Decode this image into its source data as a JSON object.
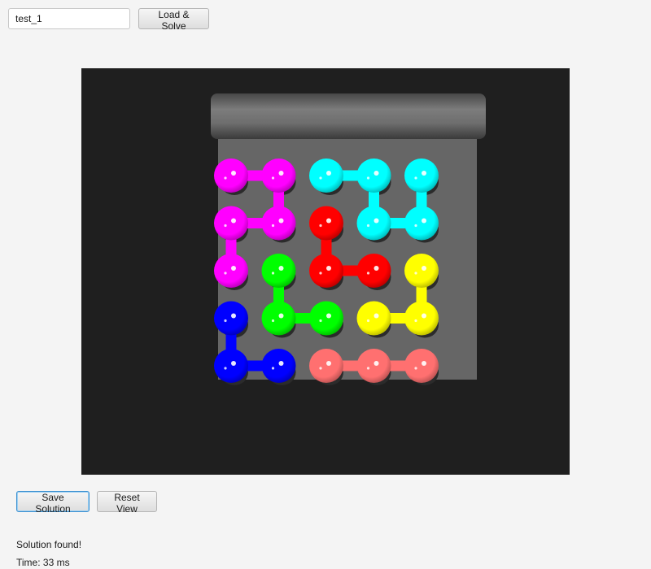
{
  "toolbar": {
    "file_input_value": "test_1",
    "load_button_label": "Load & Solve"
  },
  "puzzle": {
    "grid_rows": 5,
    "grid_cols": 5,
    "paths": [
      {
        "color": "#ff00ff",
        "cells": [
          [
            2,
            0
          ],
          [
            1,
            0
          ],
          [
            1,
            1
          ],
          [
            0,
            1
          ],
          [
            0,
            0
          ]
        ]
      },
      {
        "color": "#00ffff",
        "cells": [
          [
            0,
            2
          ],
          [
            0,
            3
          ],
          [
            1,
            3
          ],
          [
            1,
            4
          ],
          [
            0,
            4
          ]
        ]
      },
      {
        "color": "#ff0000",
        "cells": [
          [
            1,
            2
          ],
          [
            2,
            2
          ],
          [
            2,
            3
          ]
        ]
      },
      {
        "color": "#00ff00",
        "cells": [
          [
            2,
            1
          ],
          [
            3,
            1
          ],
          [
            3,
            2
          ]
        ]
      },
      {
        "color": "#ffff00",
        "cells": [
          [
            2,
            4
          ],
          [
            3,
            4
          ],
          [
            3,
            3
          ]
        ]
      },
      {
        "color": "#0000ff",
        "cells": [
          [
            3,
            0
          ],
          [
            4,
            0
          ],
          [
            4,
            1
          ]
        ]
      },
      {
        "color": "#ff7070",
        "cells": [
          [
            4,
            2
          ],
          [
            4,
            3
          ],
          [
            4,
            4
          ]
        ]
      }
    ]
  },
  "actions": {
    "save_label": "Save Solution",
    "reset_label": "Reset View"
  },
  "status": {
    "message": "Solution found!",
    "time": "Time: 33 ms"
  }
}
